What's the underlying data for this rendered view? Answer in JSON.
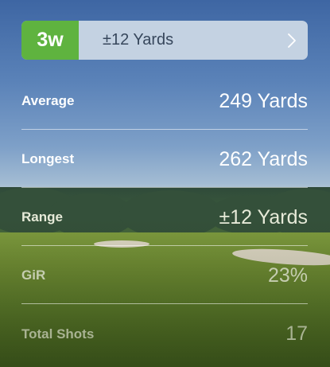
{
  "club": {
    "name": "3w",
    "range": "±12 Yards",
    "chevron_icon": "chevron-right-icon",
    "badge_color": "#5fb33f"
  },
  "stats": [
    {
      "label": "Average",
      "value": "249 Yards"
    },
    {
      "label": "Longest",
      "value": "262 Yards"
    },
    {
      "label": "Range",
      "value": "±12 Yards"
    },
    {
      "label": "GiR",
      "value": "23%"
    },
    {
      "label": "Total Shots",
      "value": "17"
    }
  ]
}
